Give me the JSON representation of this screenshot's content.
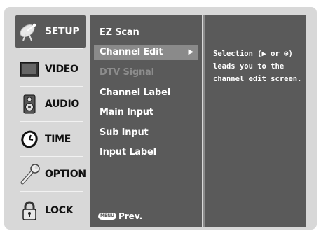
{
  "sidebar": {
    "items": [
      {
        "label": "SETUP",
        "icon": "satellite-dish-icon",
        "active": true
      },
      {
        "label": "VIDEO",
        "icon": "tv-screen-icon",
        "active": false
      },
      {
        "label": "AUDIO",
        "icon": "speaker-icon",
        "active": false
      },
      {
        "label": "TIME",
        "icon": "clock-icon",
        "active": false
      },
      {
        "label": "OPTION",
        "icon": "wrench-icon",
        "active": false
      },
      {
        "label": "LOCK",
        "icon": "padlock-icon",
        "active": false
      }
    ]
  },
  "menu": {
    "items": [
      {
        "label": "EZ Scan",
        "state": "normal"
      },
      {
        "label": "Channel Edit",
        "state": "selected"
      },
      {
        "label": "DTV Signal",
        "state": "disabled"
      },
      {
        "label": "Channel Label",
        "state": "normal"
      },
      {
        "label": "Main Input",
        "state": "normal"
      },
      {
        "label": "Sub Input",
        "state": "normal"
      },
      {
        "label": "Input Label",
        "state": "normal"
      }
    ],
    "arrow": "▶",
    "prev_key": "MENU",
    "prev_label": "Prev."
  },
  "help": {
    "text": "Selection (▶ or ⊙)\nleads you to the\nchannel edit screen."
  },
  "colors": {
    "panel": "#5a5a5a",
    "frame": "#d8d8d8",
    "highlight": "#8a8a8a",
    "disabled_text": "#8c8c8c"
  }
}
